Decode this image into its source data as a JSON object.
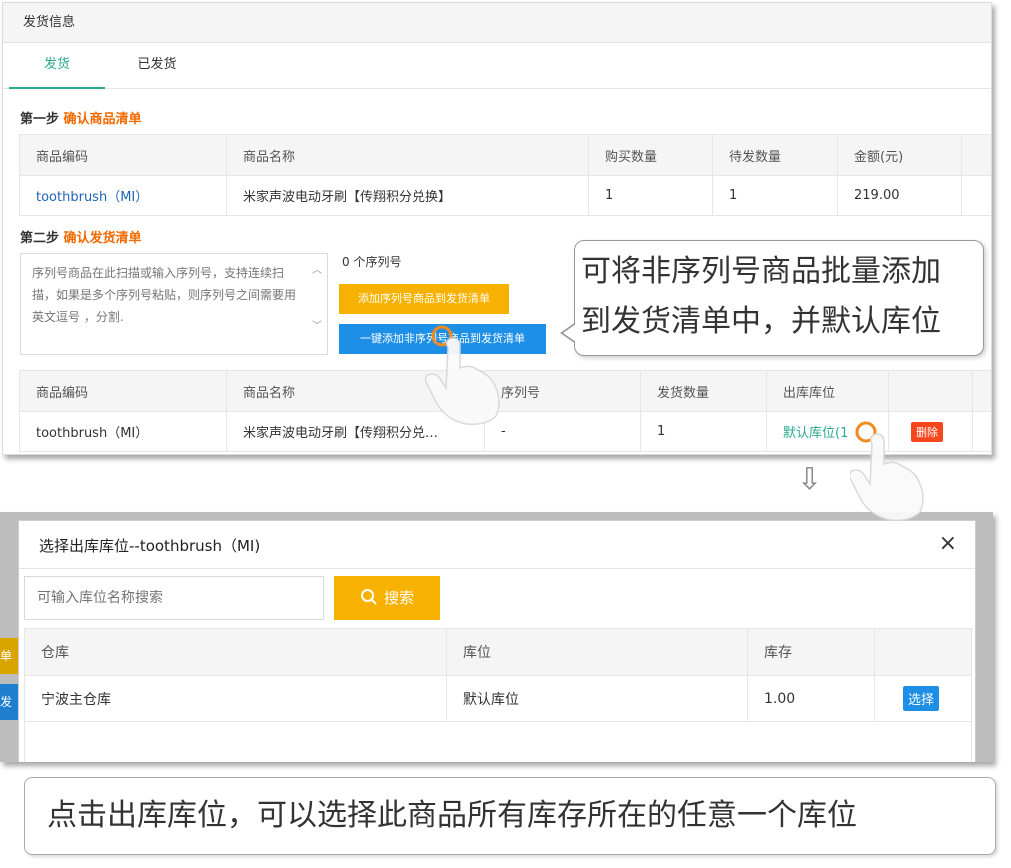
{
  "panel": {
    "title": "发货信息",
    "tabs": [
      "发货",
      "已发货"
    ]
  },
  "step1": {
    "prefix": "第一步",
    "label": "确认商品清单",
    "headers": [
      "商品编码",
      "商品名称",
      "购买数量",
      "待发数量",
      "金额(元)"
    ],
    "row": {
      "code": "toothbrush（MI）",
      "name": "米家声波电动牙刷【传翔积分兑换】",
      "qty": "1",
      "pending": "1",
      "amount": "219.00"
    }
  },
  "step2": {
    "prefix": "第二步",
    "label": "确认发货清单",
    "textarea_placeholder": "序列号商品在此扫描或输入序列号，支持连续扫描，如果是多个序列号粘贴，则序列号之间需要用英文逗号 ，分割.",
    "serial_count": "0 个序列号",
    "add_serial_btn": "添加序列号商品到发货清单",
    "add_nonserial_btn": "一键添加非序列号商品到发货清单",
    "headers": [
      "商品编码",
      "商品名称",
      "序列号",
      "发货数量",
      "出库库位"
    ],
    "row": {
      "code": "toothbrush（MI）",
      "name": "米家声波电动牙刷【传翔积分兑…",
      "serial": "-",
      "qty": "1",
      "location": "默认库位(1",
      "delete": "删除"
    }
  },
  "callout_top": {
    "line1": "可将非序列号商品批量添加",
    "line2": "到发货清单中，并默认库位"
  },
  "arrow": "⇩",
  "dialog": {
    "title": "选择出库库位--toothbrush（MI)",
    "close": "×",
    "search_placeholder": "可输入库位名称搜索",
    "search_btn": "搜索",
    "headers": [
      "仓库",
      "库位",
      "库存",
      ""
    ],
    "row": {
      "warehouse": "宁波主仓库",
      "location": "默认库位",
      "stock": "1.00",
      "select": "选择"
    },
    "side_labels": [
      "单",
      "发"
    ]
  },
  "callout_bottom": "点击出库库位，可以选择此商品所有库存所在的任意一个库位",
  "colors": {
    "accent_green": "#2aa98e",
    "orange": "#f7b100",
    "blue": "#1e8fe6",
    "red": "#f5461e",
    "step_highlight": "#f06a00"
  }
}
